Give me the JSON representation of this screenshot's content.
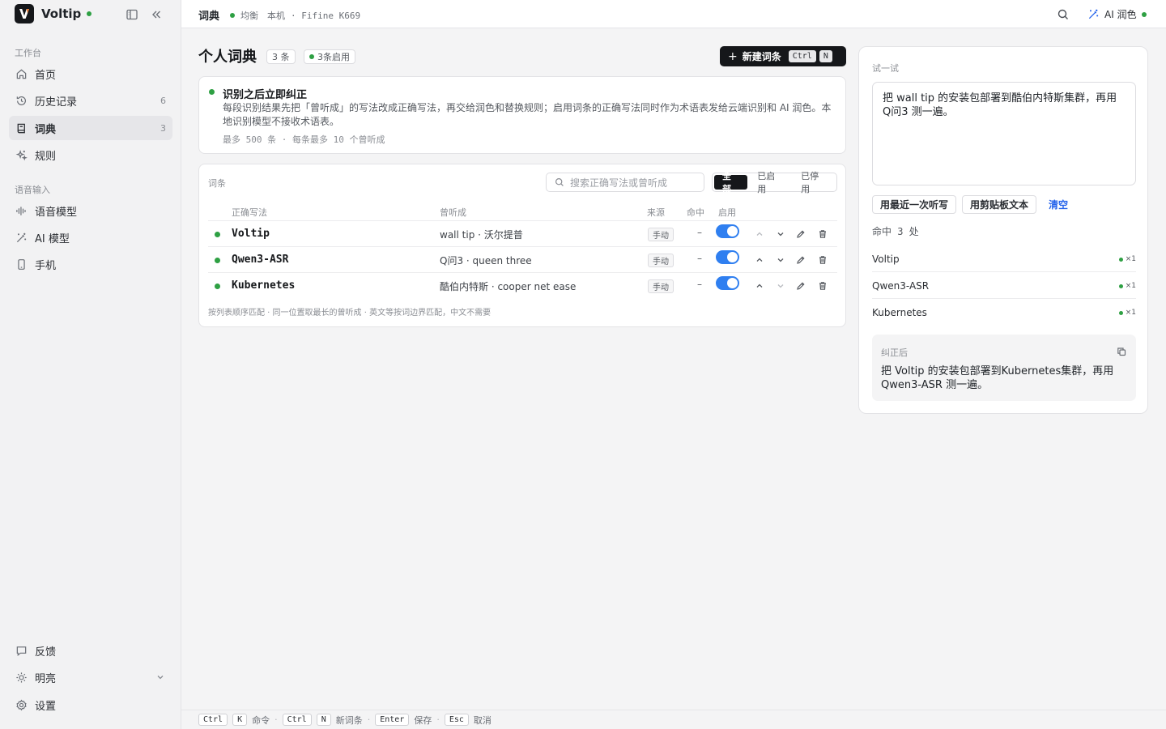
{
  "app": {
    "name": "Voltip"
  },
  "sidebar": {
    "sections": [
      "工作台",
      "语音输入"
    ],
    "items": [
      {
        "label": "首页",
        "count": ""
      },
      {
        "label": "历史记录",
        "count": "6"
      },
      {
        "label": "词典",
        "count": "3"
      },
      {
        "label": "规则",
        "count": ""
      },
      {
        "label": "语音模型",
        "count": ""
      },
      {
        "label": "AI 模型",
        "count": ""
      },
      {
        "label": "手机",
        "count": ""
      }
    ],
    "bottom": [
      {
        "label": "反馈"
      },
      {
        "label": "明亮"
      },
      {
        "label": "设置"
      }
    ]
  },
  "header": {
    "title": "词典",
    "mode": "均衡",
    "location": "本机",
    "device": "· Fifine K669",
    "ai_label": "AI 润色"
  },
  "main": {
    "title": "个人词典",
    "count_pill": "3 条",
    "enabled_pill": "3条启用",
    "new_button": {
      "label": "新建词条",
      "key1": "Ctrl",
      "key2": "N"
    },
    "info": {
      "title": "识别之后立即纠正",
      "body": "每段识别结果先把「曾听成」的写法改成正确写法，再交给润色和替换规则；启用词条的正确写法同时作为术语表发给云端识别和 AI 润色。本地识别模型不接收术语表。",
      "footer": "最多 500 条 · 每条最多 10 个曾听成"
    },
    "table": {
      "label": "词条",
      "search_placeholder": "搜索正确写法或曾听成",
      "filters": [
        "全部",
        "已启用",
        "已停用"
      ],
      "headers": [
        "正确写法",
        "曾听成",
        "来源",
        "命中",
        "启用"
      ],
      "rows": [
        {
          "term": "Voltip",
          "heard": "wall tip · 沃尔提普",
          "source": "手动",
          "hits": "–",
          "enabled": true
        },
        {
          "term": "Qwen3-ASR",
          "heard": "Q问3 · queen three",
          "source": "手动",
          "hits": "–",
          "enabled": true
        },
        {
          "term": "Kubernetes",
          "heard": "酷伯内特斯 · cooper net ease",
          "source": "手动",
          "hits": "–",
          "enabled": true
        }
      ],
      "footer": "按列表顺序匹配 · 同一位置取最长的曾听成 · 英文等按词边界匹配，中文不需要"
    }
  },
  "tryit": {
    "label": "试一试",
    "input_text": "把 wall tip 的安装包部署到酷伯内特斯集群，再用 Q问3 测一遍。",
    "btn_last": "用最近一次听写",
    "btn_clipboard": "用剪贴板文本",
    "btn_clear": "清空",
    "hits_summary": "命中 3 处",
    "hits": [
      {
        "name": "Voltip",
        "count": "×1"
      },
      {
        "name": "Qwen3-ASR",
        "count": "×1"
      },
      {
        "name": "Kubernetes",
        "count": "×1"
      }
    ],
    "result_label": "纠正后",
    "result_text": "把 Voltip 的安装包部署到Kubernetes集群，再用 Qwen3-ASR 测一遍。"
  },
  "footer": {
    "hints": [
      {
        "keys": [
          "Ctrl",
          "K"
        ],
        "label": "命令"
      },
      {
        "keys": [
          "Ctrl",
          "N"
        ],
        "label": "新词条"
      },
      {
        "keys": [
          "Enter"
        ],
        "label": "保存"
      },
      {
        "keys": [
          "Esc"
        ],
        "label": "取消"
      }
    ]
  },
  "colors": {
    "accent": "#2f7ff0",
    "status_green": "#2ea043",
    "link": "#2563eb",
    "dark": "#15171a"
  }
}
